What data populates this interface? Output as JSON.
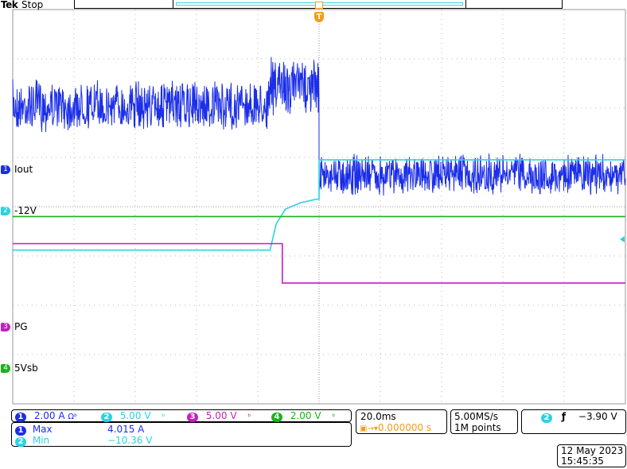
{
  "header": {
    "brand": "Tek",
    "acquisition_state": "Stop",
    "trigger_marker": "T"
  },
  "channels": [
    {
      "num": "1",
      "label": "Iout",
      "color": "#1b2ee8",
      "scale": "2.00 A",
      "coupling_icon": "Ω",
      "bw_icon": "ᵇ"
    },
    {
      "num": "2",
      "label": "-12V",
      "color": "#2ad2e2",
      "scale": "5.00 V",
      "coupling_icon": "",
      "bw_icon": "ᵇ"
    },
    {
      "num": "3",
      "label": "PG",
      "color": "#c21fc2",
      "scale": "5.00 V",
      "coupling_icon": "",
      "bw_icon": "ᵇ"
    },
    {
      "num": "4",
      "label": "5Vsb",
      "color": "#19b319",
      "scale": "2.00 V",
      "coupling_icon": "",
      "bw_icon": "ᵇ"
    }
  ],
  "measurements": [
    {
      "src": "1",
      "name": "Max",
      "value": "4.015 A"
    },
    {
      "src": "2",
      "name": "Min",
      "value": "−10.36 V"
    }
  ],
  "timebase": {
    "scale": "20.0ms",
    "trigger_position": "0.000000 s"
  },
  "acq_info": {
    "sample_rate": "5.00MS/s",
    "record_length": "1M points"
  },
  "trigger": {
    "source": "2",
    "slope_icon": "rising-edge",
    "level": "−3.90 V"
  },
  "datetime": {
    "date": "12 May 2023",
    "time": "15:45:35"
  },
  "colors": {
    "ch1": "#1b2ee8",
    "ch2": "#2ad2e2",
    "ch3": "#c21fc2",
    "ch4": "#19b319",
    "trigger": "#f39a1c"
  },
  "chart_data": {
    "type": "line",
    "x_divisions": 10,
    "y_divisions": 8,
    "trigger_division": 5,
    "series": [
      {
        "name": "Iout",
        "segments": [
          {
            "x": [
              0,
              4.2
            ],
            "y_div": 1.95,
            "noise_div": 0.55
          },
          {
            "x": [
              4.2,
              5.0
            ],
            "y_div": 1.55,
            "noise_div": 0.6
          },
          {
            "x": [
              5.0,
              10
            ],
            "y_div": 3.35,
            "noise_div": 0.45
          }
        ]
      },
      {
        "name": "-12V",
        "points": [
          [
            0,
            4.88
          ],
          [
            4.2,
            4.88
          ],
          [
            4.3,
            4.35
          ],
          [
            4.45,
            4.05
          ],
          [
            4.7,
            3.92
          ],
          [
            4.95,
            3.85
          ],
          [
            5.0,
            3.85
          ],
          [
            5.0,
            3.05
          ],
          [
            10,
            3.05
          ]
        ]
      },
      {
        "name": "PG",
        "points": [
          [
            0,
            4.75
          ],
          [
            4.4,
            4.75
          ],
          [
            4.4,
            5.55
          ],
          [
            10,
            5.55
          ]
        ]
      },
      {
        "name": "5Vsb",
        "points": [
          [
            0,
            4.2
          ],
          [
            10,
            4.2
          ]
        ]
      }
    ]
  }
}
